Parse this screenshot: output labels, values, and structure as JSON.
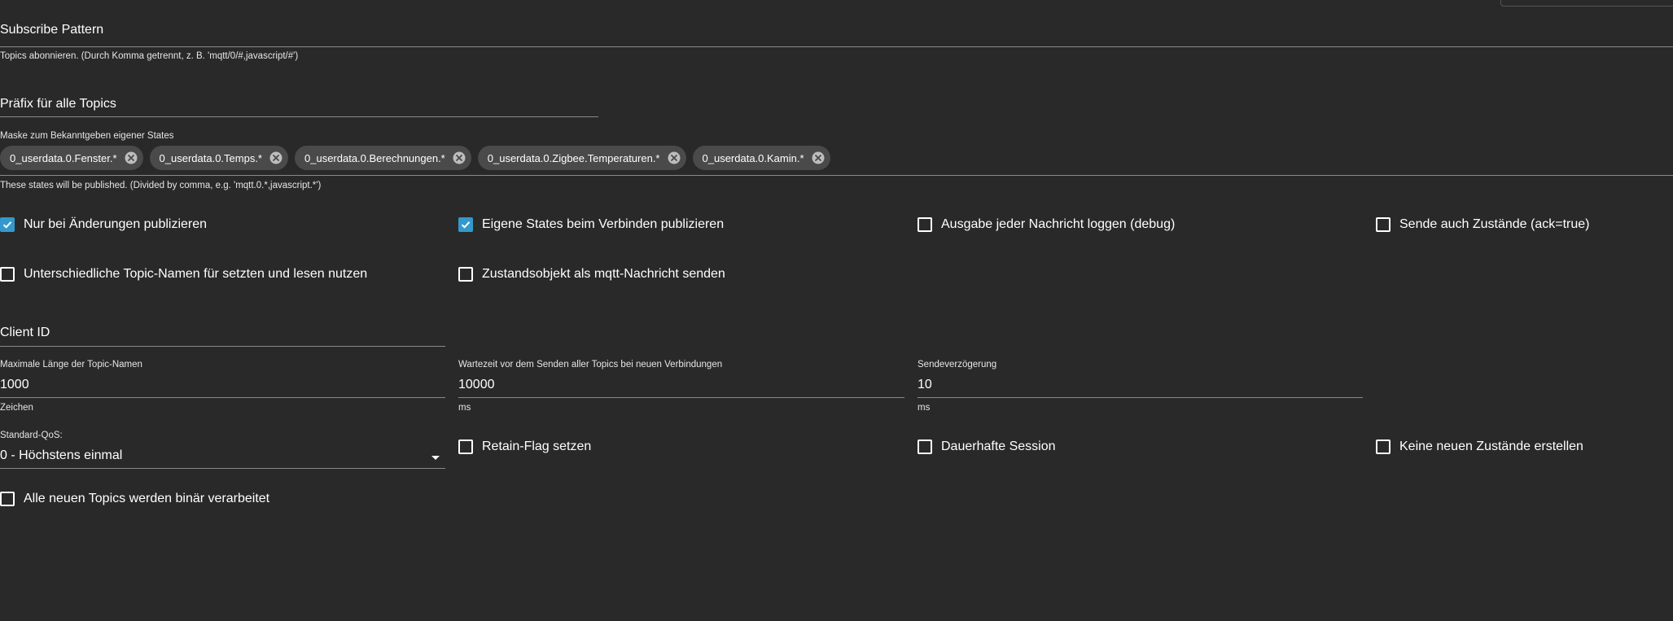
{
  "subscribe": {
    "label": "Subscribe Pattern",
    "helper": "Topics abonnieren. (Durch Komma getrennt, z. B. 'mqtt/0/#,javascript/#')"
  },
  "prefix": {
    "label": "Präfix für alle Topics"
  },
  "mask": {
    "label": "Maske zum Bekanntgeben eigener States",
    "chips": [
      "0_userdata.0.Fenster.*",
      "0_userdata.0.Temps.*",
      "0_userdata.0.Berechnungen.*",
      "0_userdata.0.Zigbee.Temperaturen.*",
      "0_userdata.0.Kamin.*"
    ],
    "helper": "These states will be published. (Divided by comma, e.g. 'mqtt.0.*,javascript.*')"
  },
  "checkboxes_row1": [
    {
      "label": "Nur bei Änderungen publizieren",
      "checked": true
    },
    {
      "label": "Eigene States beim Verbinden publizieren",
      "checked": true
    },
    {
      "label": "Ausgabe jeder Nachricht loggen (debug)",
      "checked": false
    },
    {
      "label": "Sende auch Zustände (ack=true)",
      "checked": false
    }
  ],
  "checkboxes_row2": [
    {
      "label": "Unterschiedliche Topic-Namen für setzten und lesen nutzen",
      "checked": false
    },
    {
      "label": "Zustandsobjekt als mqtt-Nachricht senden",
      "checked": false
    }
  ],
  "client_id": {
    "label": "Client ID"
  },
  "max_length": {
    "label": "Maximale Länge der Topic-Namen",
    "value": "1000",
    "unit": "Zeichen"
  },
  "wait_time": {
    "label": "Wartezeit vor dem Senden aller Topics bei neuen Verbindungen",
    "value": "10000",
    "unit": "ms"
  },
  "send_delay": {
    "label": "Sendeverzögerung",
    "value": "10",
    "unit": "ms"
  },
  "qos": {
    "label": "Standard-QoS:",
    "value": "0 - Höchstens einmal"
  },
  "checkboxes_row3": [
    {
      "label": "Retain-Flag setzen",
      "checked": false
    },
    {
      "label": "Dauerhafte Session",
      "checked": false
    },
    {
      "label": "Keine neuen Zustände erstellen",
      "checked": false
    }
  ],
  "checkbox_binary": {
    "label": "Alle neuen Topics werden binär verarbeitet",
    "checked": false
  },
  "colors": {
    "accent": "#3399cc",
    "background": "#292929",
    "chip": "#4a4a4a"
  }
}
